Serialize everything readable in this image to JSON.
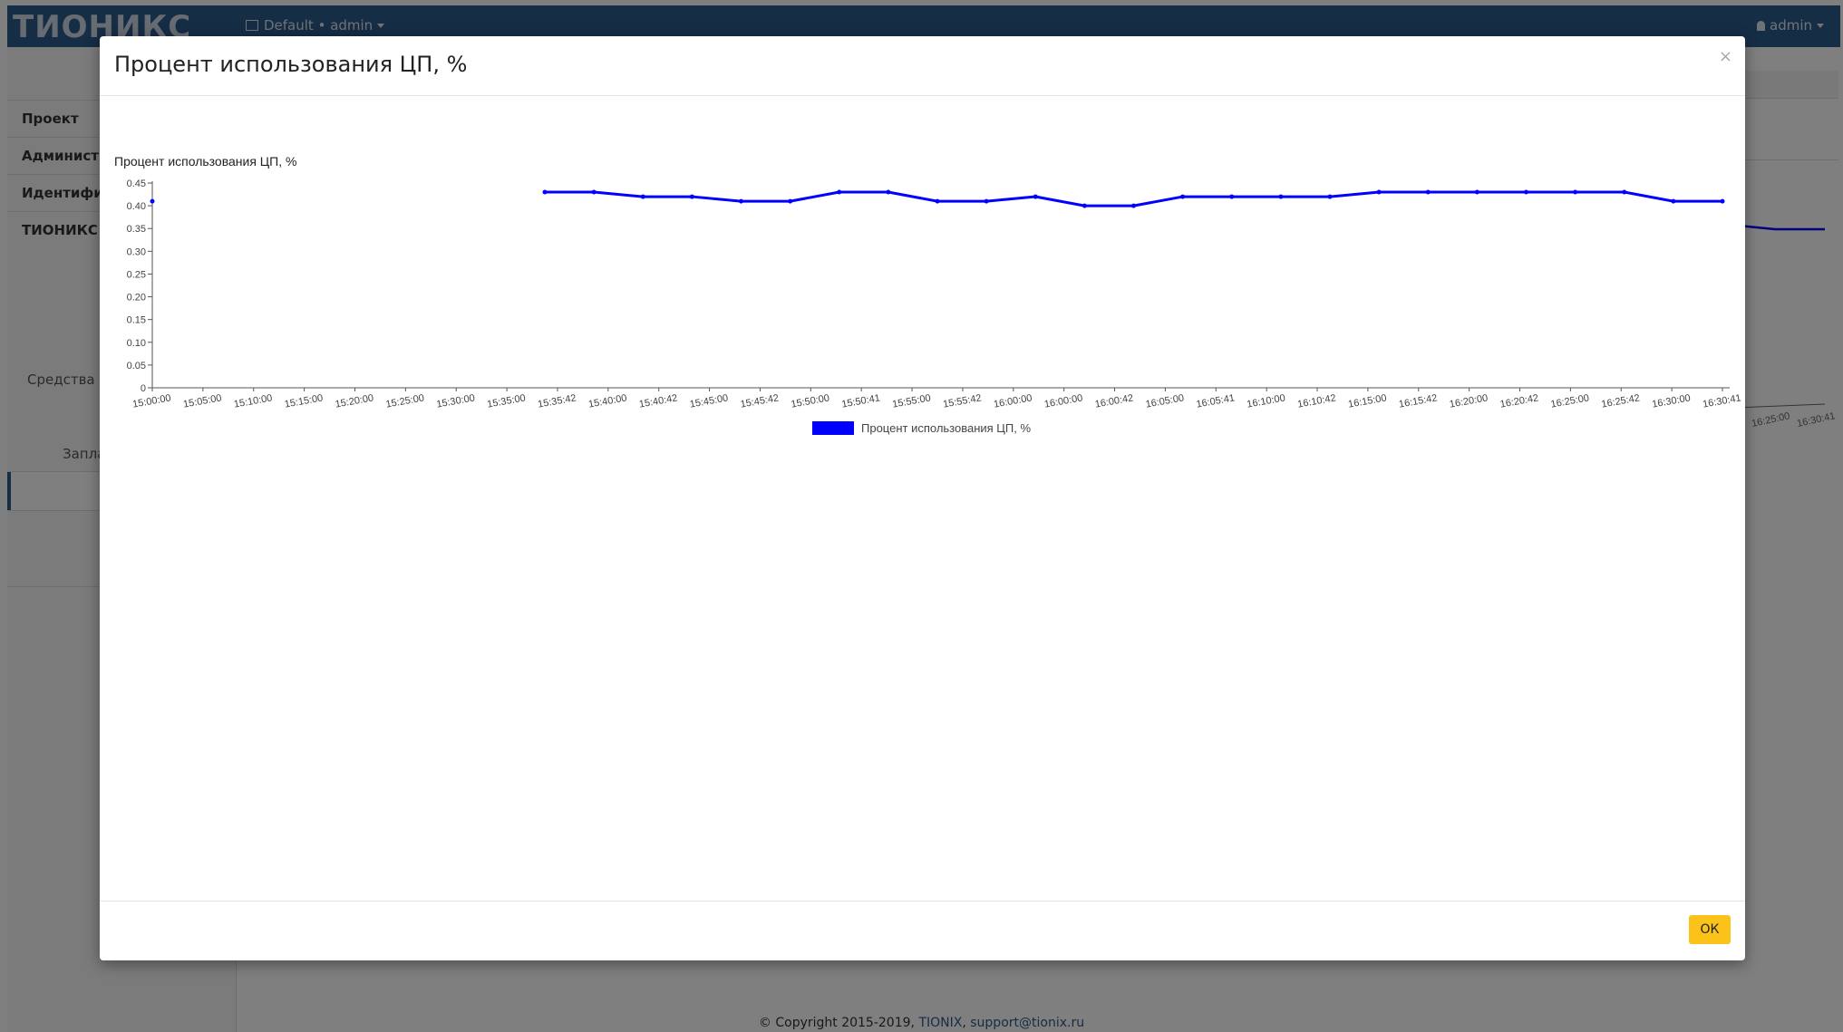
{
  "app": {
    "brand": "ТИОНИКС",
    "context_label": "Default • admin",
    "user_label": "admin",
    "sidebar": {
      "items": [
        "Проект",
        "Администратор",
        "Идентификация",
        "ТИОНИКС"
      ],
      "sub_items": [
        "Средства управления",
        "Запланированные"
      ]
    },
    "footer": {
      "copyright": "© Copyright 2015-2019,",
      "link1": "TIONIX",
      "sep": ",",
      "link2": "support@tionix.ru"
    },
    "background_chart": {
      "tick_labels": [
        "16:25:00",
        "16:30:41"
      ]
    }
  },
  "modal": {
    "title": "Процент использования ЦП, %",
    "close_label": "×",
    "ok_label": "ОК"
  },
  "colors": {
    "series": "#0000ff",
    "topbar": "#2c5a8c",
    "ok_button": "#fbc31a"
  },
  "chart_data": {
    "type": "line",
    "title": "Процент использования ЦП, %",
    "xlabel": "",
    "ylabel": "",
    "ylim": [
      0,
      0.45
    ],
    "yticks": [
      0,
      0.05,
      0.1,
      0.15,
      0.2,
      0.25,
      0.3,
      0.35,
      0.4,
      0.45
    ],
    "ytick_labels": [
      "0",
      "0.05",
      "0.10",
      "0.15",
      "0.20",
      "0.25",
      "0.30",
      "0.35",
      "0.40",
      "0.45"
    ],
    "categories": [
      "15:00:00",
      "15:05:00",
      "15:10:00",
      "15:15:00",
      "15:20:00",
      "15:25:00",
      "15:30:00",
      "15:35:00",
      "15:35:42",
      "15:40:00",
      "15:40:42",
      "15:45:00",
      "15:45:42",
      "15:50:00",
      "15:50:41",
      "15:55:00",
      "15:55:42",
      "16:00:00",
      "16:00:00",
      "16:00:42",
      "16:05:00",
      "16:05:41",
      "16:10:00",
      "16:10:42",
      "16:15:00",
      "16:15:42",
      "16:20:00",
      "16:20:42",
      "16:25:00",
      "16:25:42",
      "16:30:00",
      "16:30:41"
    ],
    "series": [
      {
        "name": "Процент использования ЦП, %",
        "color": "#0000ff",
        "values": [
          0.41,
          null,
          null,
          null,
          null,
          null,
          null,
          null,
          0.43,
          0.43,
          0.42,
          0.42,
          0.41,
          0.41,
          0.43,
          0.43,
          0.41,
          0.41,
          0.42,
          0.4,
          0.4,
          0.42,
          0.42,
          0.42,
          0.42,
          0.43,
          0.43,
          0.43,
          0.43,
          0.43,
          0.43,
          0.41,
          0.41
        ]
      }
    ],
    "grid": false,
    "legend": "bottom-center"
  }
}
